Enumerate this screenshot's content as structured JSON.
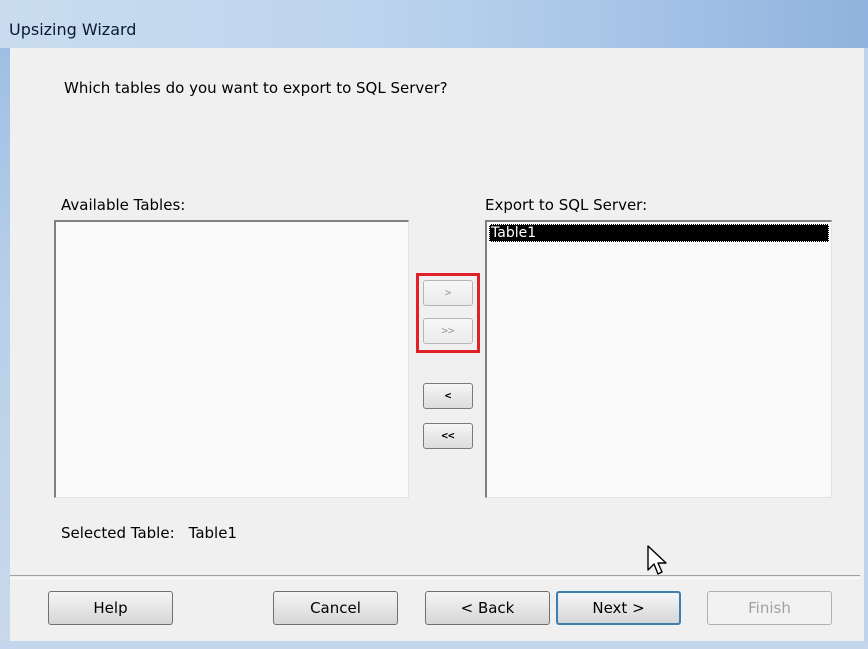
{
  "window": {
    "title": "Upsizing Wizard"
  },
  "question": "Which tables do you want to export to SQL Server?",
  "available": {
    "label": "Available Tables:",
    "items": []
  },
  "export": {
    "label": "Export to SQL Server:",
    "items": [
      "Table1"
    ]
  },
  "move_buttons": {
    "add_one": ">",
    "add_all": ">>",
    "remove_one": "<",
    "remove_all": "<<"
  },
  "selected": {
    "label": "Selected Table:",
    "value": "Table1"
  },
  "footer": {
    "help": "Help",
    "cancel": "Cancel",
    "back": "< Back",
    "next": "Next >",
    "finish": "Finish"
  },
  "colors": {
    "highlight": "#e0202a",
    "selection": "#000000"
  }
}
